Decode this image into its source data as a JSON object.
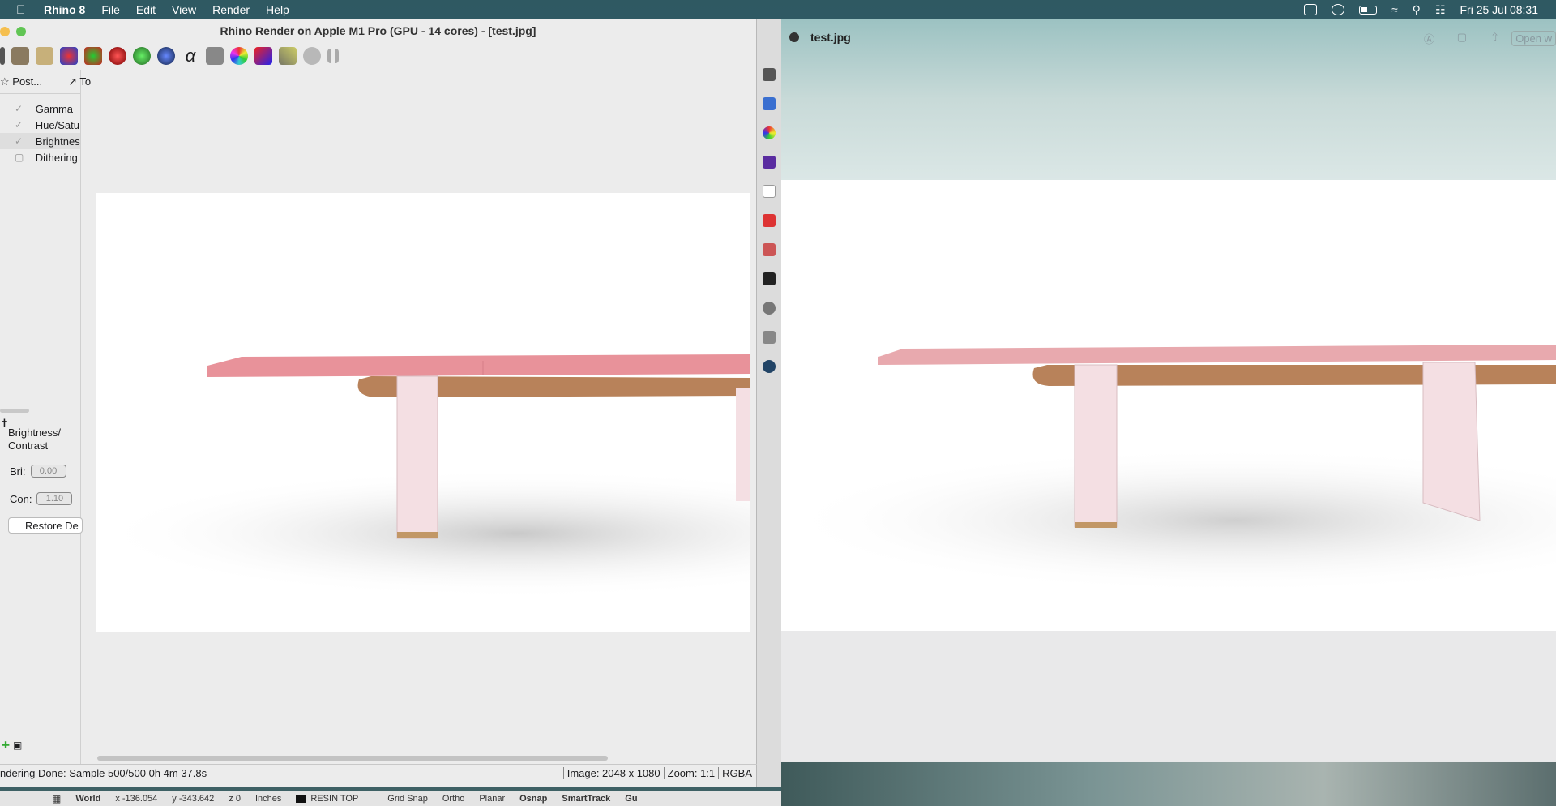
{
  "menubar": {
    "app_name": "Rhino 8",
    "menus": [
      "File",
      "Edit",
      "View",
      "Render",
      "Help"
    ],
    "clock": "Fri 25 Jul  08:31"
  },
  "rhino_window": {
    "title": "Rhino Render on Apple M1 Pro (GPU - 14 cores) - [test.jpg]",
    "tabs": [
      "Post...",
      "To"
    ],
    "post_effects": [
      {
        "label": "Gamma",
        "checked": true
      },
      {
        "label": "Hue/Satu",
        "checked": true
      },
      {
        "label": "Brightnes",
        "checked": true
      },
      {
        "label": "Dithering",
        "checked": false
      }
    ],
    "section_title": "Brightness/ Contrast",
    "brightness_label": "Bri:",
    "brightness_value": "0.00",
    "contrast_label": "Con:",
    "contrast_value": "1.10",
    "restore_label": "Restore De",
    "status_left": "ndering Done: Sample 500/500 0h 4m 37.8s",
    "status_image": "Image: 2048 x 1080",
    "status_zoom": "Zoom: 1:1",
    "status_mode": "RGBA"
  },
  "preview_window": {
    "title": "test.jpg",
    "open_label": "Open w"
  },
  "command_status": {
    "cplane": "World",
    "x": "x -136.054",
    "y": "y -343.642",
    "z": "z 0",
    "units": "Inches",
    "layer": "RESIN TOP",
    "grid_snap": "Grid Snap",
    "ortho": "Ortho",
    "planar": "Planar",
    "osnap": "Osnap",
    "smarttrack": "SmartTrack",
    "gumball": "Gu"
  },
  "colors": {
    "table_top": "#e8929a",
    "table_frame": "#b07a4e",
    "legs": "#f4dfe3"
  }
}
